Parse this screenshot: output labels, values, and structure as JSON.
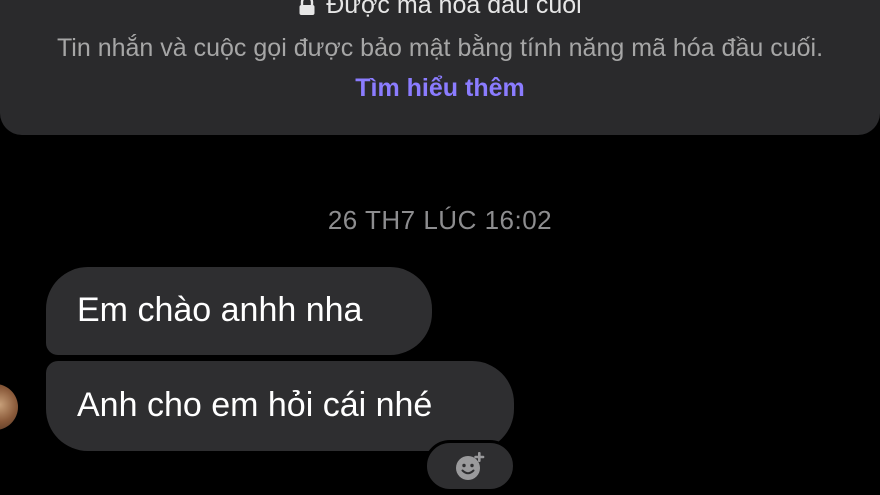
{
  "encryption_notice": {
    "title": "Được mã hóa đầu cuối",
    "description": "Tin nhắn và cuộc gọi được bảo mật bằng tính năng mã hóa đầu cuối.",
    "learn_more_label": "Tìm hiểu thêm",
    "icon": "lock-icon",
    "link_color": "#8b7cff"
  },
  "conversation": {
    "timestamp": "26 TH7 LÚC 16:02",
    "messages": [
      {
        "text": "Em chào anhh nha"
      },
      {
        "text": "Anh cho em hỏi cái nhé"
      }
    ],
    "reaction_icon": "add-emoji-icon"
  },
  "colors": {
    "background": "#000000",
    "bubble": "#2e2e30",
    "card": "#2a2a2c"
  }
}
